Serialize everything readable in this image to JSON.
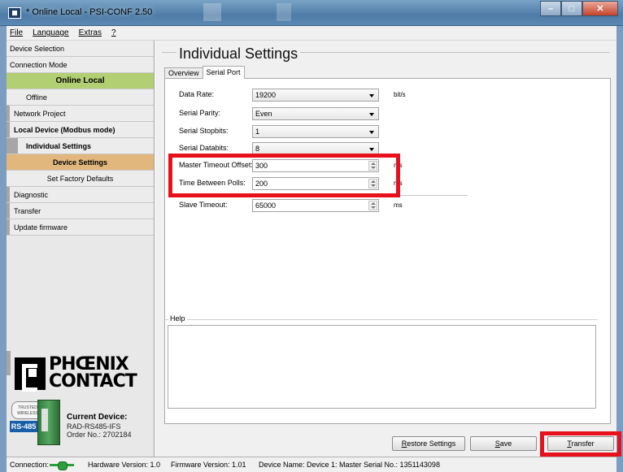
{
  "window": {
    "title": "* Online Local - PSI-CONF 2.50",
    "controls": [
      "minimize",
      "maximize",
      "close"
    ]
  },
  "menu": [
    "File",
    "Language",
    "Extras",
    "?"
  ],
  "sidebar": {
    "items": [
      {
        "label": "Device Selection"
      },
      {
        "label": "Connection Mode"
      },
      {
        "label": "Online Local"
      },
      {
        "label": "Offline"
      },
      {
        "label": "Network Project"
      },
      {
        "label": "Local Device (Modbus mode)"
      },
      {
        "label": "Individual Settings"
      },
      {
        "label": "Device Settings"
      },
      {
        "label": "Set Factory Defaults"
      },
      {
        "label": "Diagnostic"
      },
      {
        "label": "Transfer"
      },
      {
        "label": "Update firmware"
      }
    ],
    "logo_text": "PHOENIX CONTACT",
    "badge_trusted": "TRUSTED WIRELESS",
    "badge_interface": "RS-485",
    "current_device_label": "Current Device:",
    "current_device_model": "RAD-RS485-IFS",
    "current_device_order": "Order No.: 2702184"
  },
  "main": {
    "title": "Individual Settings",
    "tabs": [
      {
        "label": "Overview",
        "active": false
      },
      {
        "label": "Serial Port",
        "active": true
      }
    ],
    "fields": [
      {
        "label": "Data Rate:",
        "value": "19200",
        "kind": "select",
        "unit": "bit/s"
      },
      {
        "label": "Serial Parity:",
        "value": "Even",
        "kind": "select",
        "unit": ""
      },
      {
        "label": "Serial Stopbits:",
        "value": "1",
        "kind": "select",
        "unit": ""
      },
      {
        "label": "Serial Databits:",
        "value": "8",
        "kind": "select",
        "unit": ""
      },
      {
        "label": "Master Timeout Offset:",
        "value": "300",
        "kind": "spin",
        "unit": "ms"
      },
      {
        "label": "Time Between Polls:",
        "value": "200",
        "kind": "spin",
        "unit": "ms"
      },
      {
        "label": "Slave Timeout:",
        "value": "65000",
        "kind": "spin",
        "unit": "ms"
      }
    ],
    "help_label": "Help"
  },
  "buttons": {
    "restore": {
      "accel": "R",
      "rest": "estore Settings"
    },
    "save": {
      "accel": "S",
      "rest": "ave"
    },
    "transfer": {
      "accel": "T",
      "rest": "ransfer"
    }
  },
  "status": {
    "connection": "Connection:",
    "hardware": "Hardware Version: 1.0",
    "firmware": "Firmware Version: 1.01",
    "device": "Device Name: Device 1: Master  Serial No.: 1351143098"
  },
  "colors": {
    "highlight_box": "#e8101b",
    "nav_active_green": "#b3cf73",
    "nav_active_orange": "#e2b77d",
    "connection_indicator": "#2e9e3b"
  }
}
